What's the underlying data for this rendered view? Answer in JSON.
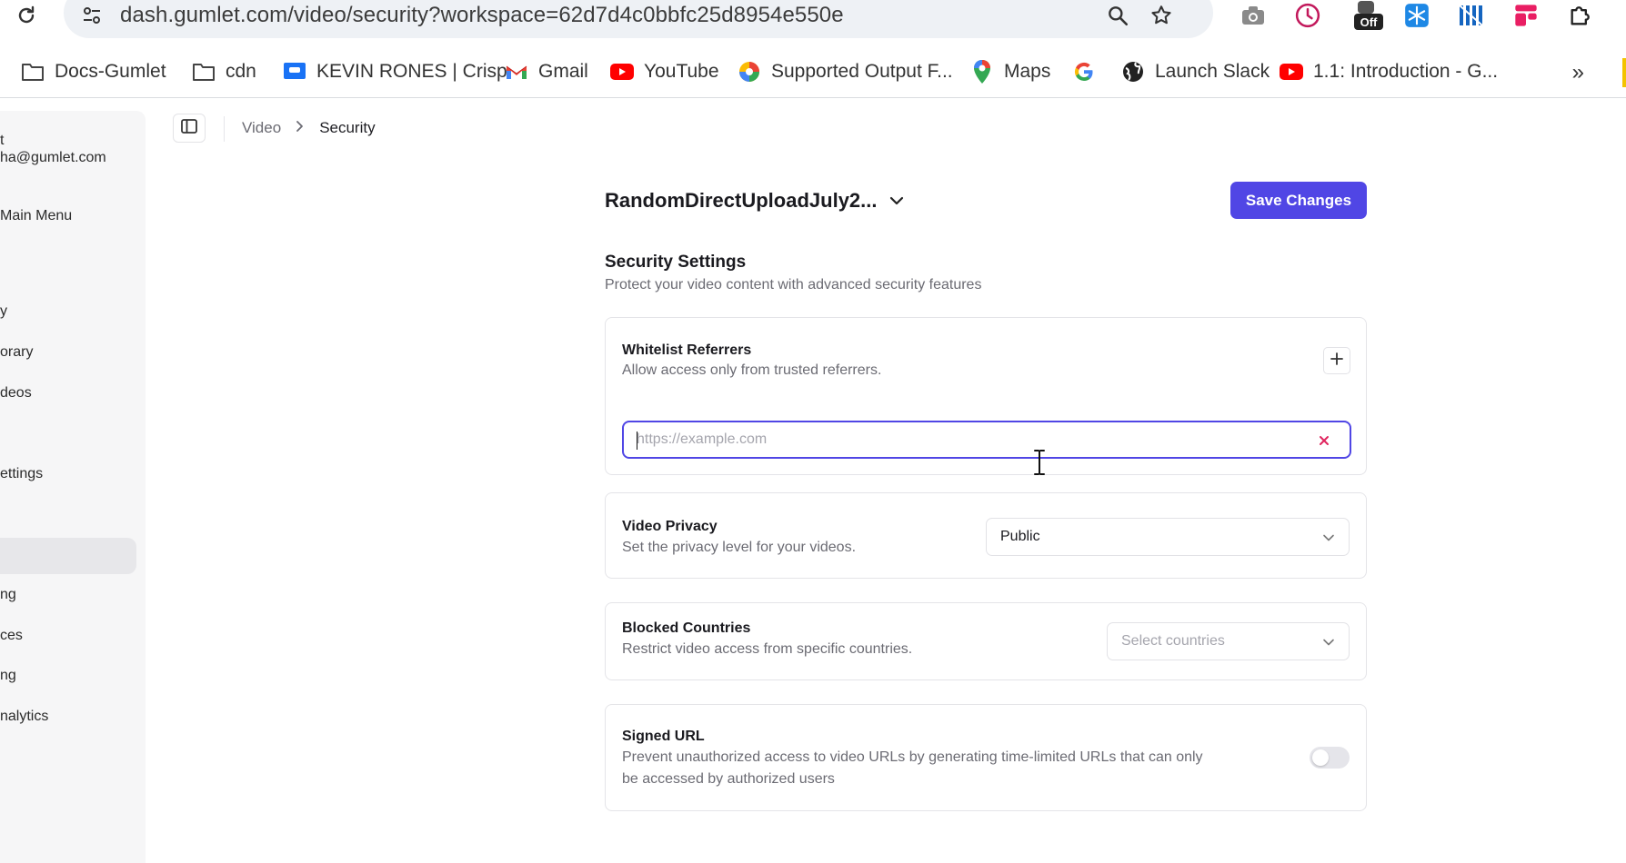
{
  "browser": {
    "url": "dash.gumlet.com/video/security?workspace=62d7d4c0bbfc25d8954e550e",
    "extension_badge": "Off",
    "bookmarks": [
      {
        "label": "Docs-Gumlet",
        "icon": "folder-icon"
      },
      {
        "label": "cdn",
        "icon": "folder-icon"
      },
      {
        "label": "KEVIN RONES | Crisp",
        "icon": "crisp-icon"
      },
      {
        "label": "Gmail",
        "icon": "gmail-icon"
      },
      {
        "label": "YouTube",
        "icon": "youtube-icon"
      },
      {
        "label": "Supported Output F...",
        "icon": "colorwheel-icon"
      },
      {
        "label": "Maps",
        "icon": "maps-pin-icon"
      },
      {
        "label": "",
        "icon": "google-icon"
      },
      {
        "label": "Launch Slack",
        "icon": "globe-icon"
      },
      {
        "label": "1.1: Introduction - G...",
        "icon": "youtube-icon"
      }
    ],
    "more_label": "»"
  },
  "sidebar": {
    "account_name": "t",
    "account_email": "ha@gumlet.com",
    "main_menu": "Main Menu",
    "items": [
      "y",
      "orary",
      "deos",
      "ettings",
      "",
      "ng",
      "ces",
      "ng",
      "nalytics"
    ]
  },
  "breadcrumb": {
    "parent": "Video",
    "current": "Security"
  },
  "workspace": {
    "name": "RandomDirectUploadJuly2...",
    "save_label": "Save Changes"
  },
  "security": {
    "title": "Security Settings",
    "subtitle": "Protect your video content with advanced security features",
    "whitelist": {
      "title": "Whitelist Referrers",
      "description": "Allow access only from trusted referrers.",
      "input_value": "",
      "input_placeholder": "https://example.com"
    },
    "privacy": {
      "title": "Video Privacy",
      "description": "Set the privacy level for your videos.",
      "selected": "Public"
    },
    "blocked": {
      "title": "Blocked Countries",
      "description": "Restrict video access from specific countries.",
      "placeholder": "Select countries"
    },
    "signed_url": {
      "title": "Signed URL",
      "description": "Prevent unauthorized access to video URLs by generating time-limited URLs that can only be accessed by authorized users",
      "enabled": false
    }
  },
  "colors": {
    "accent": "#5046e5",
    "clear_icon": "#e0245e",
    "sidebar_bg": "#f6f6f7"
  }
}
